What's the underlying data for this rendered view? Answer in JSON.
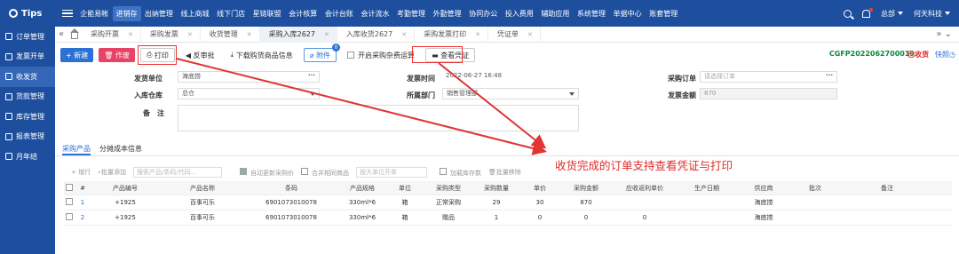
{
  "brand": "Tips",
  "topnav": [
    {
      "label": "企能易帐",
      "active": false
    },
    {
      "label": "进销存",
      "active": true
    },
    {
      "label": "出纳管理",
      "active": false
    },
    {
      "label": "线上商城",
      "active": false
    },
    {
      "label": "线下门店",
      "active": false
    },
    {
      "label": "星链联盟",
      "active": false
    },
    {
      "label": "会计核算",
      "active": false
    },
    {
      "label": "会计台账",
      "active": false
    },
    {
      "label": "会计流水",
      "active": false
    },
    {
      "label": "考勤管理",
      "active": false
    },
    {
      "label": "外勤管理",
      "active": false
    },
    {
      "label": "协同办公",
      "active": false
    },
    {
      "label": "投入费用",
      "active": false
    },
    {
      "label": "辅助应用",
      "active": false
    },
    {
      "label": "系统管理",
      "active": false
    },
    {
      "label": "单据中心",
      "active": false
    },
    {
      "label": "账套管理",
      "active": false
    }
  ],
  "user": {
    "name": "总部",
    "company": "何天科技"
  },
  "sidebar": [
    {
      "label": "订单管理",
      "active": false
    },
    {
      "label": "发票开单",
      "active": false
    },
    {
      "label": "收发货",
      "active": true
    },
    {
      "label": "货款管理",
      "active": false
    },
    {
      "label": "库存管理",
      "active": false
    },
    {
      "label": "报表管理",
      "active": false
    },
    {
      "label": "月年结",
      "active": false
    }
  ],
  "tabs": [
    {
      "label": "采购开票",
      "active": false
    },
    {
      "label": "采购发票",
      "active": false
    },
    {
      "label": "收货管理",
      "active": false
    },
    {
      "label": "采购入库2627",
      "active": true
    },
    {
      "label": "入库收货2627",
      "active": false
    },
    {
      "label": "采购发票打印",
      "active": false
    },
    {
      "label": "凭证单",
      "active": false
    }
  ],
  "toolbar": {
    "new": "+ 新建",
    "void": "作废",
    "print": "打印",
    "unapprove": "反审批",
    "download": "下载购货商品信息",
    "attach": "附件",
    "attach_count": "0",
    "misc_fee": "开启采购杂费运算",
    "view_voucher": "查看凭证",
    "doc_no": "CGFP2022062700019",
    "status": "已收货",
    "quick": "快照"
  },
  "form": {
    "supplier_label": "发货单位",
    "supplier_value": "海底捞",
    "warehouse_label": "入库仓库",
    "warehouse_value": "总仓",
    "remark_label": "备　注",
    "time_label": "发票时间",
    "time_value": "2022-06-27 16:48",
    "dept_label": "所属部门",
    "dept_value": "销售管理部",
    "po_label": "采购订单",
    "po_placeholder": "请选择订单",
    "amount_label": "发票金额",
    "amount_value": "870"
  },
  "detail_tabs": [
    {
      "label": "采购产品",
      "active": true
    },
    {
      "label": "分摊成本信息",
      "active": false
    }
  ],
  "gridbar": {
    "add_row": "+ 增行",
    "batch_add": "批量添加",
    "search_placeholder": "搜索产品/条码/代码...",
    "auto_update": "自动更新采购价",
    "merge_same": "合并相同商品",
    "unit_placeholder": "按大单位开单",
    "add_stock": "加载库存数",
    "batch_remove": "批量移除"
  },
  "table": {
    "headers": [
      "#",
      "产品编号",
      "产品名称",
      "条码",
      "产品规格",
      "单位",
      "采购类型",
      "采购数量",
      "单价",
      "采购金额",
      "应收返利单价",
      "生产日期",
      "供应商",
      "批次",
      "备注"
    ],
    "rows": [
      [
        "1",
        "+1925",
        "百事可乐",
        "6901073010078",
        "330ml*6",
        "箱",
        "正常采购",
        "29",
        "30",
        "870",
        "",
        "",
        "海底捞",
        "",
        ""
      ],
      [
        "2",
        "+1925",
        "百事可乐",
        "6901073010078",
        "330ml*6",
        "箱",
        "赠品",
        "1",
        "0",
        "0",
        "0",
        "",
        "海底捞",
        "",
        ""
      ]
    ]
  },
  "annotation": "收货完成的订单支持查看凭证与打印",
  "colors": {
    "nav": "#1e4f9e",
    "primary": "#2b71d6",
    "danger": "#e84264",
    "highlight": "#e33333",
    "doc_no": "#0a8a3c"
  }
}
